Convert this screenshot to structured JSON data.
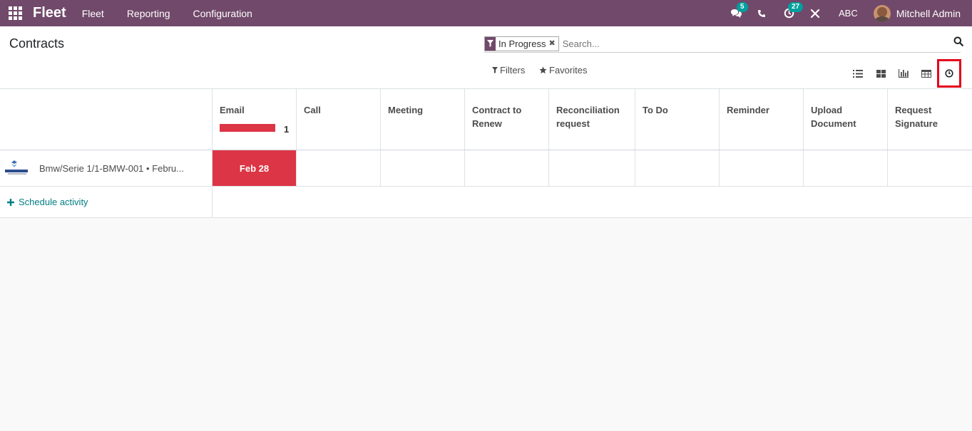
{
  "navbar": {
    "brand": "Fleet",
    "menu": [
      "Fleet",
      "Reporting",
      "Configuration"
    ],
    "messages_badge": "5",
    "activities_badge": "27",
    "company": "ABC",
    "user": "Mitchell Admin",
    "icons": [
      "apps-grid-icon",
      "chat-icon",
      "phone-icon",
      "clock-icon",
      "debug-tools-icon"
    ]
  },
  "control": {
    "title": "Contracts",
    "facet": "In Progress",
    "search_placeholder": "Search...",
    "filters_label": "Filters",
    "favorites_label": "Favorites",
    "views": [
      "list-view-icon",
      "kanban-view-icon",
      "graph-view-icon",
      "pivot-view-icon",
      "activity-view-icon"
    ],
    "active_view": "activity-view-icon"
  },
  "activity": {
    "columns": [
      {
        "label": "Email",
        "count": "1"
      },
      {
        "label": "Call"
      },
      {
        "label": "Meeting"
      },
      {
        "label": "Contract to Renew"
      },
      {
        "label": "Reconciliation request"
      },
      {
        "label": "To Do"
      },
      {
        "label": "Reminder"
      },
      {
        "label": "Upload Document"
      },
      {
        "label": "Request Signature"
      }
    ],
    "records": [
      {
        "name": "Bmw/Serie 1/1-BMW-001 • Febru...",
        "email_deadline": "Feb 28"
      }
    ],
    "schedule_label": "Schedule activity"
  },
  "colors": {
    "navbar": "#71496a",
    "badge": "#00a09d",
    "overdue": "#dc3545",
    "link": "#017e84",
    "highlight": "#e3001b"
  }
}
